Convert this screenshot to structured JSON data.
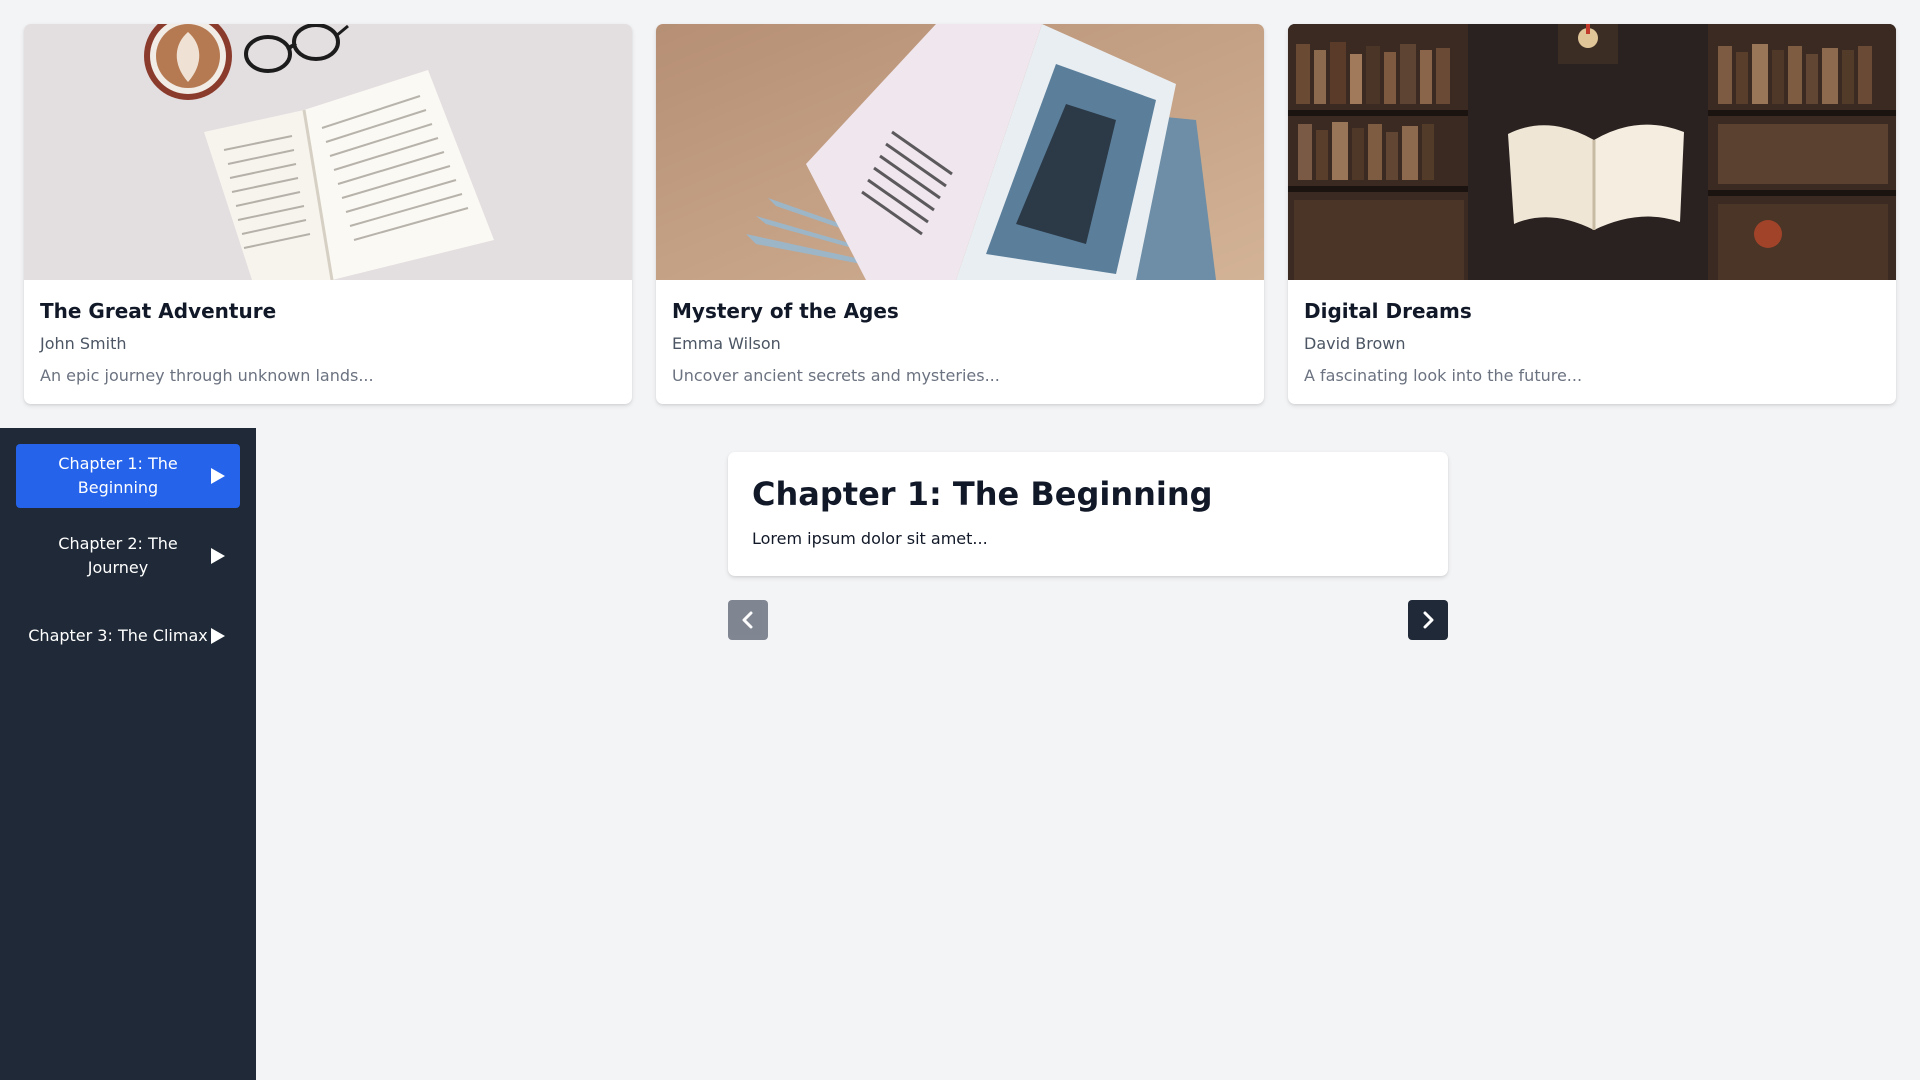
{
  "books": [
    {
      "title": "The Great Adventure",
      "author": "John Smith",
      "description": "An epic journey through unknown lands...",
      "cover_icon": "open-book-with-coffee-image"
    },
    {
      "title": "Mystery of the Ages",
      "author": "Emma Wilson",
      "description": "Uncover ancient secrets and mysteries...",
      "cover_icon": "open-magazine-image"
    },
    {
      "title": "Digital Dreams",
      "author": "David Brown",
      "description": "A fascinating look into the future...",
      "cover_icon": "library-floating-book-image"
    }
  ],
  "sidebar": {
    "chapters": [
      {
        "label": "Chapter 1: The Beginning",
        "active": true,
        "icon": "play-icon"
      },
      {
        "label": "Chapter 2: The Journey",
        "active": false,
        "icon": "play-icon"
      },
      {
        "label": "Chapter 3: The Climax",
        "active": false,
        "icon": "play-icon"
      }
    ]
  },
  "reader": {
    "chapter_title": "Chapter 1: The Beginning",
    "chapter_text": "Lorem ipsum dolor sit amet...",
    "prev_icon": "chevron-left-icon",
    "next_icon": "chevron-right-icon"
  },
  "colors": {
    "page_bg": "#f3f4f6",
    "sidebar_bg": "#1f2937",
    "active_chapter": "#2563eb",
    "prev_button": "#6b7280",
    "next_button": "#1f2937"
  }
}
